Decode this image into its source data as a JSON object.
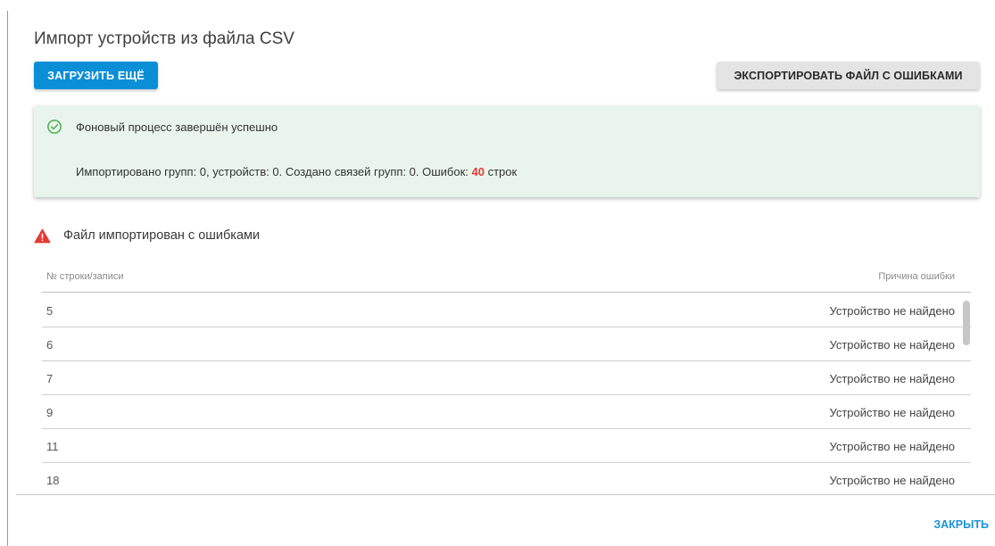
{
  "dialog": {
    "title": "Импорт устройств из файла CSV"
  },
  "toolbar": {
    "upload_more_label": "ЗАГРУЗИТЬ ЕЩЁ",
    "export_errors_label": "ЭКСПОРТИРОВАТЬ ФАЙЛ С ОШИБКАМИ"
  },
  "status": {
    "title": "Фоновый процесс завершён успешно",
    "detail_prefix": "Импортировано групп: 0, устройств: 0. Создано связей групп: 0. Ошибок: ",
    "error_count": "40",
    "detail_suffix": " строк",
    "icon": "check-circle-icon",
    "accent_color": "#4caf50",
    "error_color": "#e53935"
  },
  "warning": {
    "label": "Файл импортирован с ошибками",
    "icon": "warning-triangle-icon",
    "color": "#e53935"
  },
  "table": {
    "columns": [
      "№ строки/записи",
      "Причина ошибки"
    ],
    "rows": [
      {
        "line": "5",
        "reason": "Устройство не найдено"
      },
      {
        "line": "6",
        "reason": "Устройство не найдено"
      },
      {
        "line": "7",
        "reason": "Устройство не найдено"
      },
      {
        "line": "9",
        "reason": "Устройство не найдено"
      },
      {
        "line": "11",
        "reason": "Устройство не найдено"
      },
      {
        "line": "18",
        "reason": "Устройство не найдено"
      }
    ]
  },
  "footer": {
    "close_label": "ЗАКРЫТЬ"
  },
  "colors": {
    "primary": "#0a8fd6",
    "success_bg": "#e9f5ec"
  }
}
